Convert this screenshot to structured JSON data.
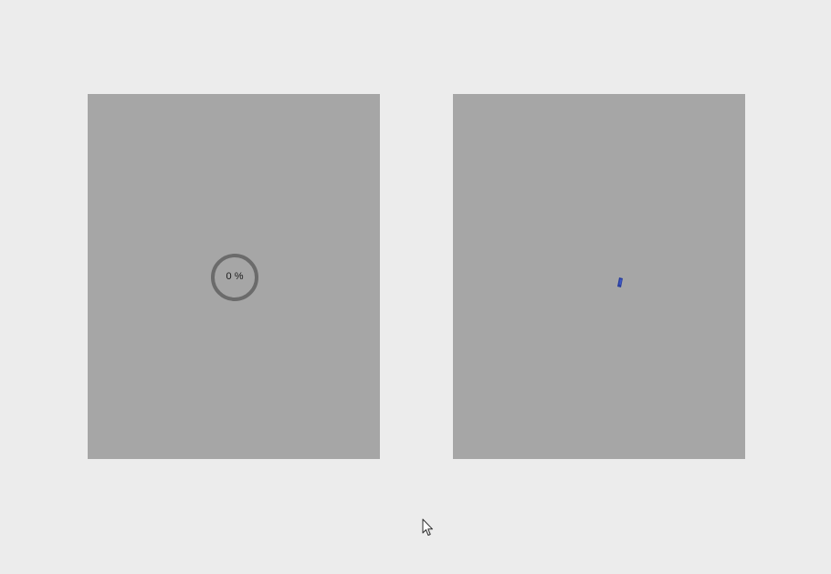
{
  "left_panel": {
    "progress": {
      "value": 0,
      "label": "0 %"
    }
  },
  "right_panel": {
    "indicator_icon": "loading-spinner-icon",
    "indicator_color": "#2a3f9e"
  },
  "cursor": {
    "icon": "mouse-pointer-icon"
  },
  "colors": {
    "background": "#ececec",
    "panel": "#a6a6a6",
    "ring": "#6b6b6b"
  }
}
